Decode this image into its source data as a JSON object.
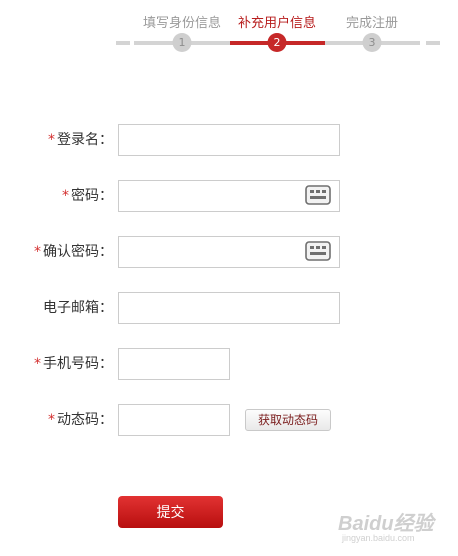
{
  "steps": [
    {
      "label": "填写身份信息",
      "number": "1",
      "state": "done"
    },
    {
      "label": "补充用户信息",
      "number": "2",
      "state": "active"
    },
    {
      "label": "完成注册",
      "number": "3",
      "state": "pending"
    }
  ],
  "form": {
    "required_marker": "*",
    "fields": {
      "username": {
        "label": "登录名：",
        "required": true,
        "value": ""
      },
      "password": {
        "label": "密码：",
        "required": true,
        "value": ""
      },
      "confirm_password": {
        "label": "确认密码：",
        "required": true,
        "value": ""
      },
      "email": {
        "label": "电子邮箱：",
        "required": false,
        "value": ""
      },
      "phone": {
        "label": "手机号码：",
        "required": true,
        "value": ""
      },
      "sms_code": {
        "label": "动态码：",
        "required": true,
        "value": ""
      }
    },
    "sms_button_label": "获取动态码",
    "submit_label": "提交"
  },
  "icons": {
    "password_keyboard": "keyboard-icon",
    "confirm_keyboard": "keyboard-icon"
  },
  "colors": {
    "accent": "#c62828",
    "required_star": "#d32f2f",
    "inactive_step": "#d4d4d4"
  },
  "watermark": {
    "logo": "Baidu经验",
    "sub": "jingyan.baidu.com"
  }
}
